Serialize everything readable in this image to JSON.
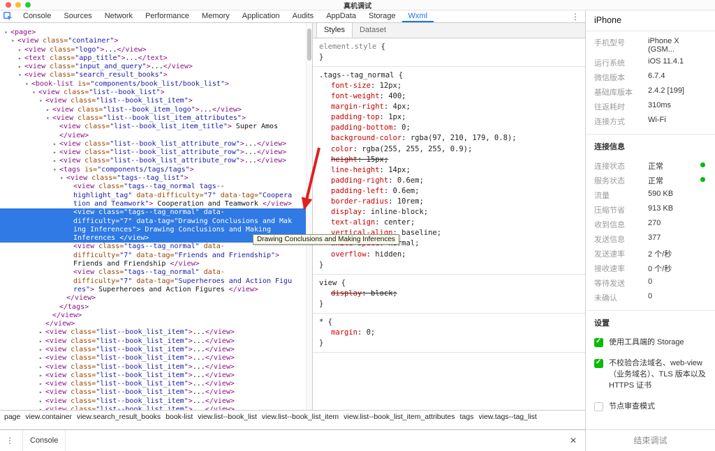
{
  "titlebar": {
    "title": "真机调试"
  },
  "devtools_tabs": [
    "Console",
    "Sources",
    "Network",
    "Performance",
    "Memory",
    "Application",
    "Audits",
    "AppData",
    "Storage",
    "Wxml"
  ],
  "active_tab": "Wxml",
  "icons": {
    "overflow_menu": "⋮",
    "drawer_menu": "⋮",
    "close": "✕",
    "expanded": "▾",
    "collapsed": "▸"
  },
  "colors": {
    "accent_blue": "#1a73e8",
    "selection_blue": "#2f7ae5",
    "wechat_green": "#09bb07",
    "annotation_red": "#e02020",
    "tag_purple": "#881280",
    "attr_orange": "#994500",
    "value_blue": "#1a1aa6",
    "property_red": "#c80000"
  },
  "tree": {
    "lines": [
      {
        "i": 0,
        "a": "v",
        "k": [
          [
            "t",
            "<page>"
          ]
        ]
      },
      {
        "i": 1,
        "a": "v",
        "k": [
          [
            "t",
            "<view"
          ],
          [
            "a",
            " class="
          ],
          [
            "v",
            "\"container\""
          ],
          [
            "t",
            ">"
          ]
        ]
      },
      {
        "i": 2,
        "a": ">",
        "k": [
          [
            "t",
            "<view"
          ],
          [
            "a",
            " class="
          ],
          [
            "v",
            "\"logo\""
          ],
          [
            "t",
            ">"
          ],
          [
            "x",
            "..."
          ],
          [
            "t",
            "</view>"
          ]
        ]
      },
      {
        "i": 2,
        "a": ">",
        "k": [
          [
            "t",
            "<text"
          ],
          [
            "a",
            " class="
          ],
          [
            "v",
            "\"app_title\""
          ],
          [
            "t",
            ">"
          ],
          [
            "x",
            "..."
          ],
          [
            "t",
            "</text>"
          ]
        ]
      },
      {
        "i": 2,
        "a": ">",
        "k": [
          [
            "t",
            "<view"
          ],
          [
            "a",
            " class="
          ],
          [
            "v",
            "\"input_and_query\""
          ],
          [
            "t",
            ">"
          ],
          [
            "x",
            "..."
          ],
          [
            "t",
            "</view>"
          ]
        ]
      },
      {
        "i": 2,
        "a": "v",
        "k": [
          [
            "t",
            "<view"
          ],
          [
            "a",
            " class="
          ],
          [
            "v",
            "\"search_result_books\""
          ],
          [
            "t",
            ">"
          ]
        ]
      },
      {
        "i": 3,
        "a": "v",
        "k": [
          [
            "t",
            "<book-list"
          ],
          [
            "a",
            " is="
          ],
          [
            "v",
            "\"components/book_list/book_list\""
          ],
          [
            "t",
            ">"
          ]
        ]
      },
      {
        "i": 4,
        "a": "v",
        "k": [
          [
            "t",
            "<view"
          ],
          [
            "a",
            " class="
          ],
          [
            "v",
            "\"list--book_list\""
          ],
          [
            "t",
            ">"
          ]
        ]
      },
      {
        "i": 5,
        "a": "v",
        "k": [
          [
            "t",
            "<view"
          ],
          [
            "a",
            " class="
          ],
          [
            "v",
            "\"list--book_list_item\""
          ],
          [
            "t",
            ">"
          ]
        ]
      },
      {
        "i": 6,
        "a": ">",
        "k": [
          [
            "t",
            "<view"
          ],
          [
            "a",
            " class="
          ],
          [
            "v",
            "\"list--book_item_logo\""
          ],
          [
            "t",
            ">"
          ],
          [
            "x",
            "..."
          ],
          [
            "t",
            "</view>"
          ]
        ]
      },
      {
        "i": 6,
        "a": "v",
        "k": [
          [
            "t",
            "<view"
          ],
          [
            "a",
            " class="
          ],
          [
            "v",
            "\"list--book_list_item_attributes\""
          ],
          [
            "t",
            ">"
          ]
        ]
      },
      {
        "i": 7,
        "a": "",
        "k": [
          [
            "t",
            "<view"
          ],
          [
            "a",
            " class="
          ],
          [
            "v",
            "\"list--book_list_item_title\""
          ],
          [
            "t",
            ">"
          ],
          [
            "x",
            " Super Amos"
          ]
        ]
      },
      {
        "i": 7,
        "a": "",
        "k": [
          [
            "t",
            "</view>"
          ]
        ]
      },
      {
        "i": 7,
        "a": ">",
        "r": 3,
        "k": [
          [
            "t",
            "<view"
          ],
          [
            "a",
            " class="
          ],
          [
            "v",
            "\"list--book_list_attribute_row\""
          ],
          [
            "t",
            ">"
          ],
          [
            "x",
            "..."
          ],
          [
            "t",
            "</view>"
          ]
        ]
      },
      {
        "i": 7,
        "a": "v",
        "k": [
          [
            "t",
            "<tags"
          ],
          [
            "a",
            " is="
          ],
          [
            "v",
            "\"components/tags/tags\""
          ],
          [
            "t",
            ">"
          ]
        ]
      },
      {
        "i": 8,
        "a": "v",
        "k": [
          [
            "t",
            "<view"
          ],
          [
            "a",
            " class="
          ],
          [
            "v",
            "\"tags--tag_list\""
          ],
          [
            "t",
            ">"
          ]
        ]
      },
      {
        "i": 9,
        "a": "",
        "k": [
          [
            "t",
            "<view"
          ],
          [
            "a",
            " class="
          ],
          [
            "v",
            "\"tags--tag_normal tags--"
          ]
        ]
      },
      {
        "i": 9,
        "a": "",
        "k": [
          [
            "v",
            "highlight_tag\""
          ],
          [
            "a",
            " data-difficulty="
          ],
          [
            "v",
            "\"7\""
          ],
          [
            "a",
            " data-tag="
          ],
          [
            "v",
            "\"Coopera"
          ]
        ]
      },
      {
        "i": 9,
        "a": "",
        "k": [
          [
            "v",
            "tion and Teamwork\""
          ],
          [
            "t",
            ">"
          ],
          [
            "x",
            " Cooperation and Teamwork "
          ],
          [
            "t",
            "</view>"
          ]
        ]
      },
      {
        "i": 9,
        "a": "",
        "s": true,
        "k": [
          [
            "t",
            "<view"
          ],
          [
            "a",
            " class="
          ],
          [
            "v",
            "\"tags--tag_normal\""
          ],
          [
            "a",
            " data-"
          ]
        ]
      },
      {
        "i": 9,
        "a": "",
        "s": true,
        "k": [
          [
            "a",
            "difficulty="
          ],
          [
            "v",
            "\"7\""
          ],
          [
            "a",
            " data-tag="
          ],
          [
            "v",
            "\"Drawing Conclusions and Mak"
          ]
        ]
      },
      {
        "i": 9,
        "a": "",
        "s": true,
        "k": [
          [
            "v",
            "ing Inferences\""
          ],
          [
            "t",
            ">"
          ],
          [
            "x",
            " Drawing Conclusions and Making"
          ]
        ]
      },
      {
        "i": 9,
        "a": "",
        "s": true,
        "k": [
          [
            "x",
            "Inferences "
          ],
          [
            "t",
            "</view>"
          ]
        ]
      },
      {
        "i": 9,
        "a": "",
        "k": [
          [
            "t",
            "<view"
          ],
          [
            "a",
            " class="
          ],
          [
            "v",
            "\"tags--tag_normal\""
          ],
          [
            "a",
            " data-"
          ]
        ]
      },
      {
        "i": 9,
        "a": "",
        "k": [
          [
            "a",
            "difficulty="
          ],
          [
            "v",
            "\"7\""
          ],
          [
            "a",
            " data-tag="
          ],
          [
            "v",
            "\"Friends and Friendship\""
          ],
          [
            "t",
            ">"
          ]
        ]
      },
      {
        "i": 9,
        "a": "",
        "k": [
          [
            "x",
            "Friends and Friendship "
          ],
          [
            "t",
            "</view>"
          ]
        ]
      },
      {
        "i": 9,
        "a": "",
        "k": [
          [
            "t",
            "<view"
          ],
          [
            "a",
            " class="
          ],
          [
            "v",
            "\"tags--tag_normal\""
          ],
          [
            "a",
            " data-"
          ]
        ]
      },
      {
        "i": 9,
        "a": "",
        "k": [
          [
            "a",
            "difficulty="
          ],
          [
            "v",
            "\"7\""
          ],
          [
            "a",
            " data-tag="
          ],
          [
            "v",
            "\"Superheroes and Action Figu"
          ]
        ]
      },
      {
        "i": 9,
        "a": "",
        "k": [
          [
            "v",
            "res\""
          ],
          [
            "t",
            ">"
          ],
          [
            "x",
            " Superheroes and Action Figures "
          ],
          [
            "t",
            "</view>"
          ]
        ]
      },
      {
        "i": 8,
        "a": "",
        "k": [
          [
            "t",
            "</view>"
          ]
        ]
      },
      {
        "i": 7,
        "a": "",
        "k": [
          [
            "t",
            "</tags>"
          ]
        ]
      },
      {
        "i": 6,
        "a": "",
        "k": [
          [
            "t",
            "</view>"
          ]
        ]
      },
      {
        "i": 5,
        "a": "",
        "k": [
          [
            "t",
            "</view>"
          ]
        ]
      },
      {
        "i": 5,
        "a": ">",
        "r": 10,
        "k": [
          [
            "t",
            "<view"
          ],
          [
            "a",
            " class="
          ],
          [
            "v",
            "\"list--book_list_item\""
          ],
          [
            "t",
            ">"
          ],
          [
            "x",
            "..."
          ],
          [
            "t",
            "</view>"
          ]
        ]
      }
    ]
  },
  "styles": {
    "tabs": [
      "Styles",
      "Dataset"
    ],
    "active": "Styles",
    "rules": [
      {
        "selector": "element.style",
        "gray": true,
        "props": []
      },
      {
        "selector": ".tags--tag_normal",
        "props": [
          {
            "n": "font-size",
            "v": "12px"
          },
          {
            "n": "font-weight",
            "v": "400"
          },
          {
            "n": "margin-right",
            "v": "4px"
          },
          {
            "n": "padding-top",
            "v": "1px"
          },
          {
            "n": "padding-bottom",
            "v": "0"
          },
          {
            "n": "background-color",
            "v": "rgba(97, 210, 179, 0.8)"
          },
          {
            "n": "color",
            "v": "rgba(255, 255, 255, 0.9)"
          },
          {
            "n": "height",
            "v": "15px",
            "struck": true
          },
          {
            "n": "line-height",
            "v": "14px"
          },
          {
            "n": "padding-right",
            "v": "0.6em"
          },
          {
            "n": "padding-left",
            "v": "0.6em"
          },
          {
            "n": "border-radius",
            "v": "10rem"
          },
          {
            "n": "display",
            "v": "inline-block"
          },
          {
            "n": "text-align",
            "v": "center"
          },
          {
            "n": "vertical-align",
            "v": "baseline"
          },
          {
            "n": "white-space",
            "v": "normal"
          },
          {
            "n": "overflow",
            "v": "hidden"
          }
        ]
      },
      {
        "selector": "view",
        "props": [
          {
            "n": "display",
            "v": "block",
            "struck": true
          }
        ]
      },
      {
        "selector": "*",
        "props": [
          {
            "n": "margin",
            "v": "0"
          }
        ]
      }
    ]
  },
  "tooltip": "Drawing Conclusions and Making Inferences",
  "breadcrumb": [
    "page",
    "view.container",
    "view.search_result_books",
    "book-list",
    "view.list--book_list",
    "view.list--book_list_item",
    "view.list--book_list_item_attributes",
    "tags",
    "view.tags--tag_list"
  ],
  "console_bar": {
    "label": "Console"
  },
  "device": {
    "title": "iPhone",
    "info": [
      {
        "label": "手机型号",
        "value": "iPhone X (GSM..."
      },
      {
        "label": "运行系统",
        "value": "iOS 11.4.1"
      },
      {
        "label": "微信版本",
        "value": "6.7.4"
      },
      {
        "label": "基础库版本",
        "value": "2.4.2 [199]"
      },
      {
        "label": "往返耗时",
        "value": "310ms"
      },
      {
        "label": "连接方式",
        "value": "Wi-Fi"
      }
    ],
    "conn_title": "连接信息",
    "conn": [
      {
        "label": "连接状态",
        "value": "正常",
        "dot": true
      },
      {
        "label": "服务状态",
        "value": "正常",
        "dot": true
      },
      {
        "label": "流量",
        "value": "590 KB"
      },
      {
        "label": "压缩节省",
        "value": "913 KB"
      },
      {
        "label": "收到信息",
        "value": "270"
      },
      {
        "label": "发送信息",
        "value": "377"
      },
      {
        "label": "发送速率",
        "value": "2 个/秒"
      },
      {
        "label": "接收速率",
        "value": "0 个/秒"
      },
      {
        "label": "等待发送",
        "value": "0"
      },
      {
        "label": "未确认",
        "value": "0"
      }
    ],
    "settings_title": "设置",
    "settings": [
      {
        "label": "使用工具端的 Storage",
        "checked": true
      },
      {
        "label": "不校验合法域名、web-view（业务域名）、TLS 版本以及 HTTPS 证书",
        "checked": true
      },
      {
        "label": "节点审查模式",
        "checked": false
      }
    ],
    "end_button": "结束调试"
  }
}
